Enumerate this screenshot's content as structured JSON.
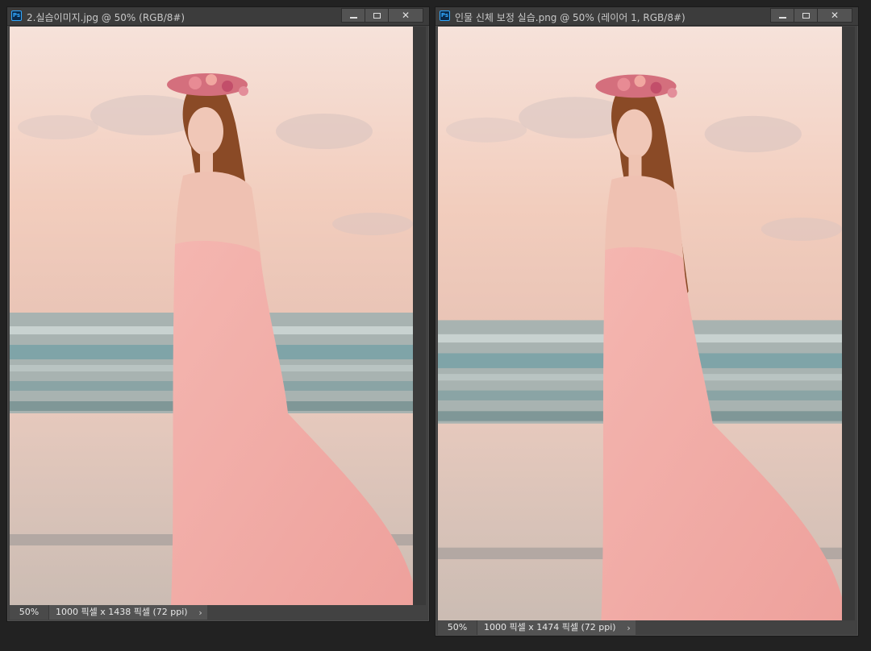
{
  "windows": [
    {
      "title": "2.실습이미지.jpg @ 50% (RGB/8#)",
      "zoom": "50%",
      "doc_info": "1000 픽셀 x 1438 픽셀 (72 ppi)",
      "arrow": "›",
      "close_glyph": "✕"
    },
    {
      "title": "인물 신체 보정 실습.png @ 50% (레이어 1, RGB/8#)",
      "zoom": "50%",
      "doc_info": "1000 픽셀 x 1474 픽셀 (72 ppi)",
      "arrow": "›",
      "close_glyph": "✕"
    }
  ],
  "app_icon": "Ps",
  "colors": {
    "sky_top": "#f6ddd2",
    "sky_bottom": "#f1c6b3",
    "sea": "#8fa6a5",
    "sand": "#d9c7bd",
    "dress": "#f2aaa6",
    "hair": "#8a4a26"
  }
}
